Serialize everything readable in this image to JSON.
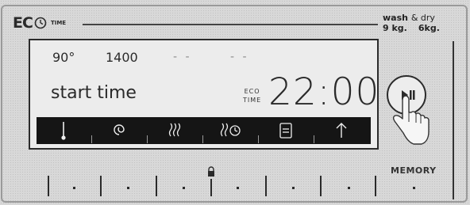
{
  "brand": {
    "eco": "EC",
    "time": "TIME",
    "wash_dry_line1": "wash",
    "wash_dry_amp": "& dry",
    "wash_weight": "9 kg.",
    "dry_weight": "6kg."
  },
  "display": {
    "temperature": "90°",
    "spin": "1400",
    "option_3": "- -",
    "option_4": "- -",
    "start_label": "start time",
    "eco_small_1": "ECO",
    "eco_small_2": "TIME",
    "clock": "22:00"
  },
  "icon_bar": [
    {
      "name": "temperature-icon"
    },
    {
      "name": "spin-icon"
    },
    {
      "name": "steam-icon"
    },
    {
      "name": "dry-timer-icon"
    },
    {
      "name": "program-icon"
    },
    {
      "name": "arrow-up-icon"
    }
  ],
  "buttons": {
    "memory": "MEMORY",
    "start_pause": "start-pause-icon"
  },
  "colors": {
    "panel_bg": "#d8d8d8",
    "display_bg": "#ececec",
    "icon_bar_bg": "#151515",
    "ink": "#2a2a2a"
  }
}
